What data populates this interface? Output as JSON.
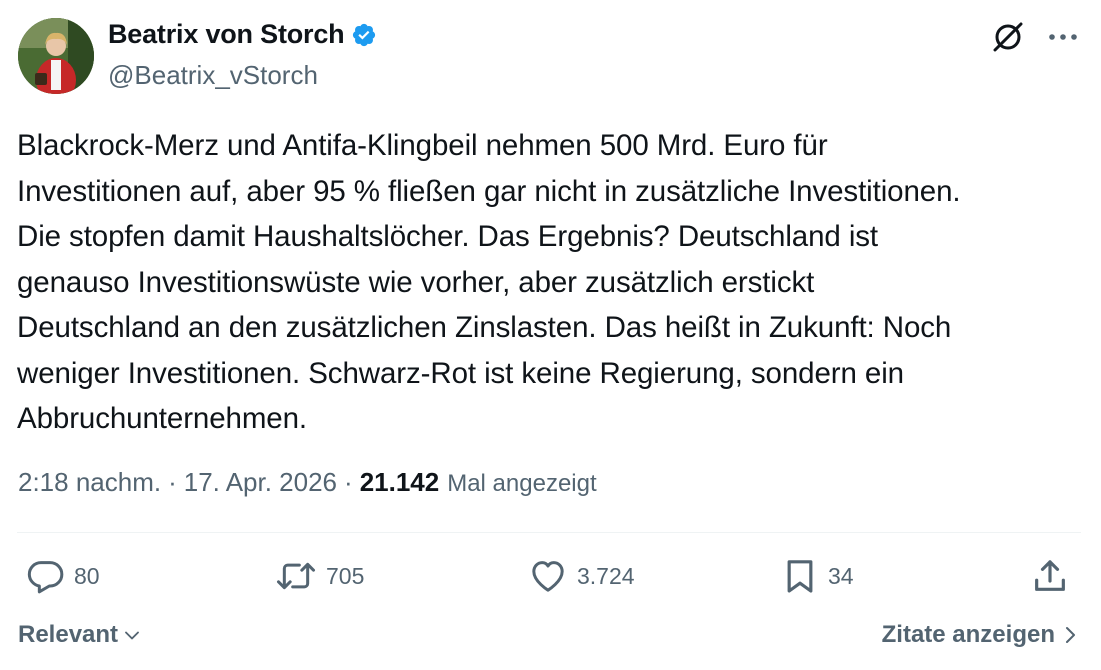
{
  "author": {
    "display_name": "Beatrix von Storch",
    "handle": "@Beatrix_vStorch",
    "verified_icon": "verified-badge-icon",
    "verified_color": "#1d9bf0"
  },
  "tweet": {
    "text": "Blackrock-Merz und Antifa-Klingbeil nehmen 500 Mrd. Euro für\nInvestitionen auf, aber 95 % fließen gar nicht in zusätzliche Investitionen.\nDie stopfen damit Haushaltslöcher. Das Ergebnis? Deutschland ist\ngenauso Investitionswüste wie vorher, aber zusätzlich erstickt\nDeutschland an den zusätzlichen Zinslasten. Das heißt in Zukunft: Noch\nweniger Investitionen. Schwarz-Rot ist keine Regierung, sondern ein\nAbbruchunternehmen."
  },
  "meta": {
    "time": "2:18 nachm.",
    "separator": "·",
    "date": "17. Apr. 2026",
    "views_count": "21.142",
    "views_label": "Mal angezeigt"
  },
  "actions": {
    "replies": "80",
    "reposts": "705",
    "likes": "3.724",
    "bookmarks": "34"
  },
  "footer": {
    "sort_label": "Relevant",
    "quotes_label": "Zitate anzeigen"
  },
  "colors": {
    "text": "#0f1419",
    "secondary": "#536471",
    "divider": "#eff3f4"
  }
}
